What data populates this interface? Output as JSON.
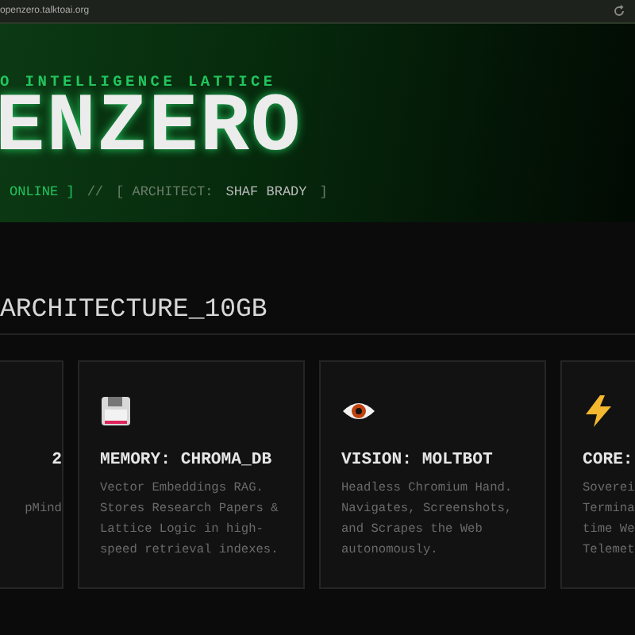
{
  "browser": {
    "url": "openzero.talktoai.org"
  },
  "hero": {
    "subtitle": "O INTELLIGENCE LATTICE",
    "title": "ENZERO",
    "status": {
      "state": "ONLINE ]",
      "separator": "//",
      "architect_label": "[ ARCHITECT:",
      "architect": "SHAF BRADY",
      "close": "]"
    }
  },
  "section": {
    "title": "ARCHITECTURE_10GB"
  },
  "cards": [
    {
      "kind": "none",
      "title": "2",
      "lines": [
        "pMind"
      ]
    },
    {
      "kind": "floppy",
      "title": "MEMORY: CHROMA_DB",
      "lines": [
        "Vector Embeddings RAG.",
        "Stores Research Papers &",
        "Lattice Logic in high-",
        "speed retrieval indexes."
      ]
    },
    {
      "kind": "eye",
      "title": "VISION: MOLTBOT",
      "lines": [
        "Headless Chromium Hand.",
        "Navigates, Screenshots,",
        "and Scrapes the Web",
        "autonomously."
      ]
    },
    {
      "kind": "bolt",
      "title": "CORE:",
      "lines": [
        "Soverei",
        "Termina",
        "time We",
        "Telemet"
      ]
    }
  ]
}
